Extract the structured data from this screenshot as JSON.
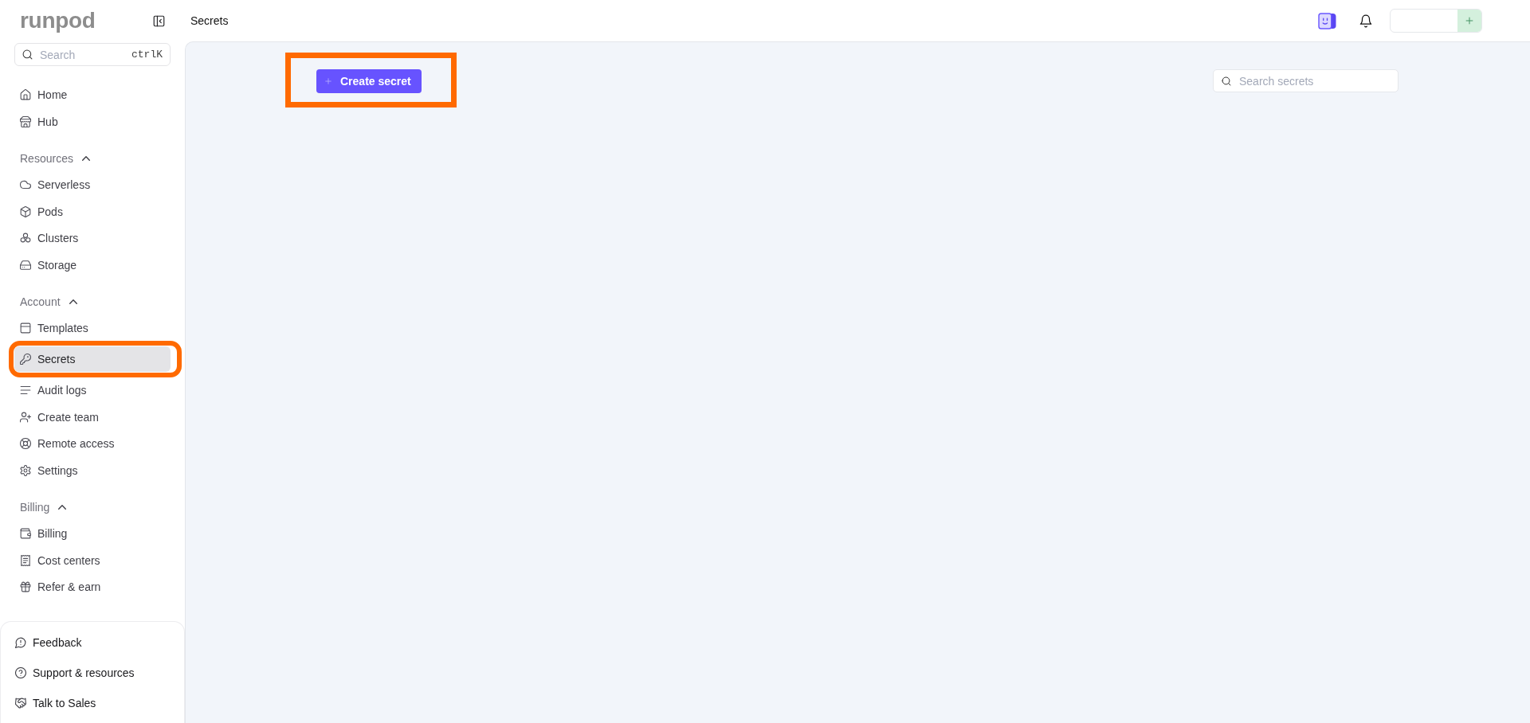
{
  "sidebar": {
    "logo": "runpod",
    "search": {
      "placeholder": "Search",
      "shortcut": "ctrlK"
    },
    "sections": [
      {
        "items": [
          {
            "label": "Home",
            "selected": false,
            "highlighted": false
          },
          {
            "label": "Hub",
            "selected": false,
            "highlighted": false
          }
        ]
      },
      {
        "title": "Resources",
        "expanded": true,
        "items": [
          {
            "label": "Serverless",
            "selected": false,
            "highlighted": false
          },
          {
            "label": "Pods",
            "selected": false,
            "highlighted": false
          },
          {
            "label": "Clusters",
            "selected": false,
            "highlighted": false
          },
          {
            "label": "Storage",
            "selected": false,
            "highlighted": false
          }
        ]
      },
      {
        "title": "Account",
        "expanded": true,
        "items": [
          {
            "label": "Templates",
            "selected": false,
            "highlighted": false
          },
          {
            "label": "Secrets",
            "selected": true,
            "highlighted": true
          },
          {
            "label": "Audit logs",
            "selected": false,
            "highlighted": false
          },
          {
            "label": "Create team",
            "selected": false,
            "highlighted": false
          },
          {
            "label": "Remote access",
            "selected": false,
            "highlighted": false
          },
          {
            "label": "Settings",
            "selected": false,
            "highlighted": false
          }
        ]
      },
      {
        "title": "Billing",
        "expanded": true,
        "items": [
          {
            "label": "Billing",
            "selected": false,
            "highlighted": false
          },
          {
            "label": "Cost centers",
            "selected": false,
            "highlighted": false
          },
          {
            "label": "Refer & earn",
            "selected": false,
            "highlighted": false
          }
        ]
      }
    ],
    "footer_links": [
      "Feedback",
      "Support & resources",
      "Talk to Sales"
    ]
  },
  "top_bar": {
    "breadcrumb": "Secrets"
  },
  "main": {
    "create_button": {
      "label": "Create secret",
      "highlighted": true
    },
    "search": {
      "placeholder": "Search secrets"
    }
  }
}
